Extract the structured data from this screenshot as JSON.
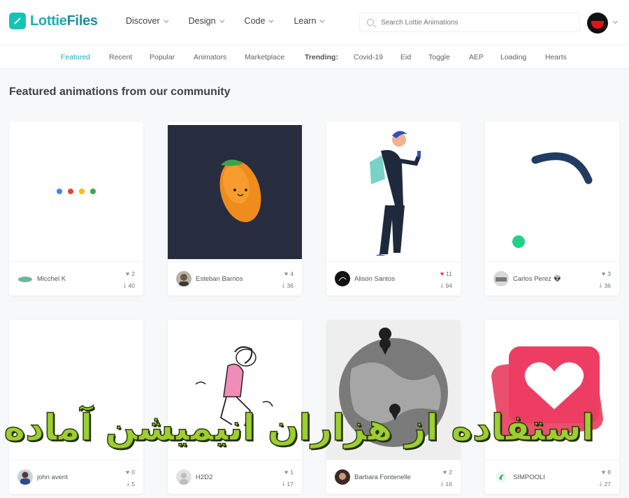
{
  "brand": {
    "name_part1": "Lottie",
    "name_part2": "Files",
    "color": "#19c3b4"
  },
  "nav": [
    {
      "label": "Discover"
    },
    {
      "label": "Design"
    },
    {
      "label": "Code"
    },
    {
      "label": "Learn"
    }
  ],
  "search": {
    "placeholder": "Search Lottie Animations"
  },
  "subnav": [
    {
      "label": "Featured",
      "active": true
    },
    {
      "label": "Recent"
    },
    {
      "label": "Popular"
    },
    {
      "label": "Animators"
    },
    {
      "label": "Marketplace"
    },
    {
      "label": "Trending:",
      "heading": true
    },
    {
      "label": "Covid-19"
    },
    {
      "label": "Eid"
    },
    {
      "label": "Toggle"
    },
    {
      "label": "AEP"
    },
    {
      "label": "Loading"
    },
    {
      "label": "Hearts"
    }
  ],
  "heading": "Featured animations from our community",
  "cards": [
    {
      "author": "Micchel K",
      "likes": "2",
      "downloads": "40",
      "liked": false
    },
    {
      "author": "Esteban Barrios",
      "likes": "4",
      "downloads": "36",
      "liked": false
    },
    {
      "author": "Alison Santos",
      "likes": "11",
      "downloads": "94",
      "liked": true
    },
    {
      "author": "Carlos Perez 👽",
      "likes": "3",
      "downloads": "36",
      "liked": false
    },
    {
      "author": "john avent",
      "likes": "0",
      "downloads": "5",
      "liked": false
    },
    {
      "author": "H2D2",
      "likes": "1",
      "downloads": "17",
      "liked": false
    },
    {
      "author": "Barbara Fontenelle",
      "likes": "2",
      "downloads": "16",
      "liked": false
    },
    {
      "author": "SIMPOOLI",
      "likes": "8",
      "downloads": "27",
      "liked": false
    }
  ],
  "overlay_text": "استفاده از هزاران انیمیشن آماده",
  "colors": {
    "accent": "#19aeb0",
    "liked": "#e0323f",
    "overlay": "#9ccf2f"
  }
}
